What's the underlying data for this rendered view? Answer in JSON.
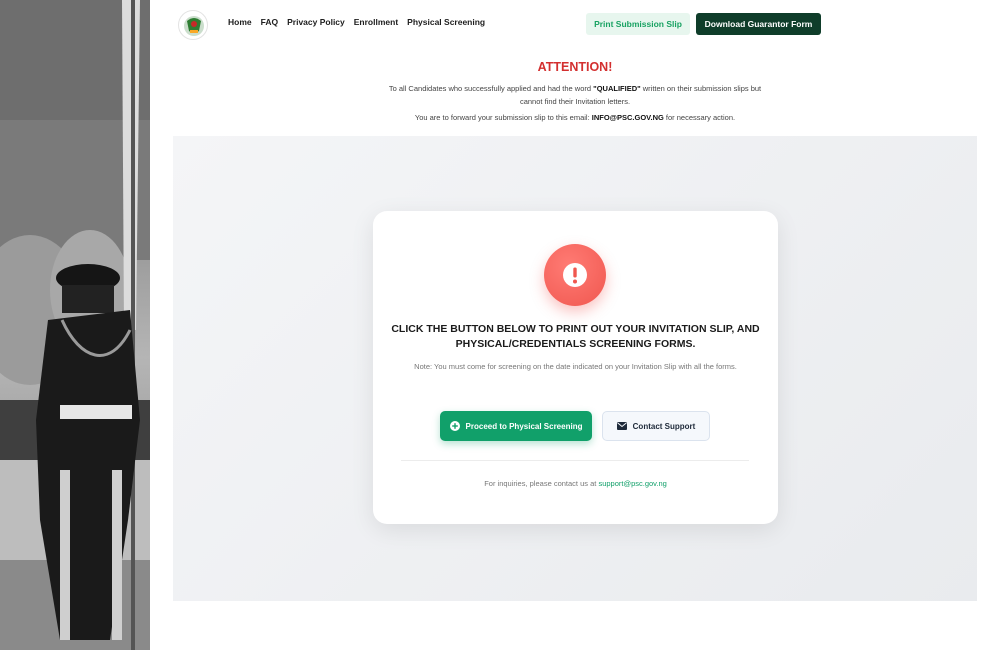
{
  "nav": {
    "items": [
      {
        "label": "Home"
      },
      {
        "label": "FAQ"
      },
      {
        "label": "Privacy Policy"
      },
      {
        "label": "Enrollment"
      },
      {
        "label": "Physical Screening"
      }
    ]
  },
  "header": {
    "print_label": "Print Submission Slip",
    "guarantor_label": "Download Guarantor Form",
    "logo_icon": "coat-of-arms-icon"
  },
  "attention": {
    "title": "ATTENTION!",
    "p1_pre": "To all Candidates who successfully applied and had the word ",
    "p1_bold": "\"QUALIFIED\"",
    "p1_post": " written on their submission slips but cannot find their Invitation letters.",
    "p2_pre": "You are to forward your submission slip to this email: ",
    "p2_email": "INFO@PSC.GOV.NG",
    "p2_post": " for necessary action."
  },
  "card": {
    "icon": "exclamation-icon",
    "title": "CLICK THE BUTTON BELOW TO PRINT OUT YOUR INVITATION SLIP, AND PHYSICAL/CREDENTIALS SCREENING FORMS.",
    "note": "Note: You must come for screening on the date indicated on your Invitation Slip with all the forms.",
    "proceed_label": "Proceed to Physical Screening",
    "contact_label": "Contact Support",
    "inquiries_text": "For inquiries, please contact us at ",
    "support_email": "support@psc.gov.ng"
  },
  "colors": {
    "brand_green": "#11a06a",
    "dark_green": "#0f3d2a",
    "alert_red": "#f0574f",
    "attention_red": "#d32f2f"
  }
}
